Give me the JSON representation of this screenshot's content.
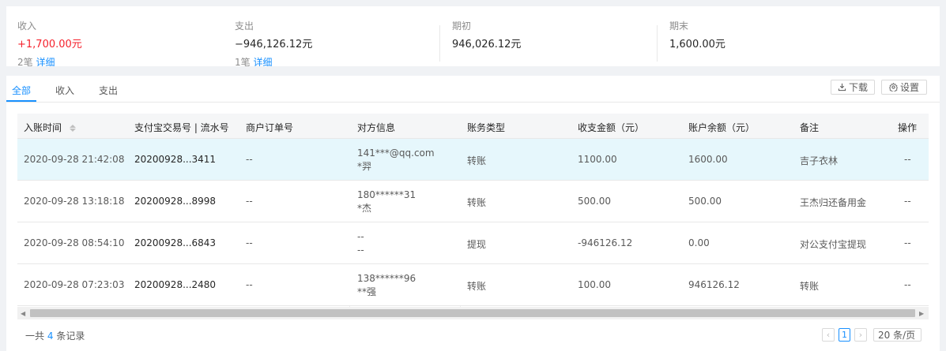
{
  "summary": {
    "income": {
      "label": "收入",
      "value": "+1,700.00元",
      "sub_count": "2笔",
      "sub_link": "详细"
    },
    "expense": {
      "label": "支出",
      "value": "−946,126.12元",
      "sub_count": "1笔",
      "sub_link": "详细"
    },
    "opening": {
      "label": "期初",
      "value": "946,026.12元"
    },
    "closing": {
      "label": "期末",
      "value": "1,600.00元"
    }
  },
  "tabs": [
    {
      "label": "全部",
      "active": true
    },
    {
      "label": "收入",
      "active": false
    },
    {
      "label": "支出",
      "active": false
    }
  ],
  "toolbar": {
    "download_label": "下载",
    "settings_label": "设置"
  },
  "table": {
    "columns": [
      "入账时间",
      "支付宝交易号 | 流水号",
      "商户订单号",
      "对方信息",
      "账务类型",
      "收支金额（元）",
      "账户余额（元）",
      "备注",
      "操作"
    ],
    "rows": [
      {
        "time": "2020-09-28 21:42:08",
        "trade_no": "20200928...3411",
        "order_no": "--",
        "party_account": "141***@qq.com",
        "party_name": "*羿",
        "type": "转账",
        "amount": "1100.00",
        "balance": "1600.00",
        "remark": "吉子衣林",
        "action": "--"
      },
      {
        "time": "2020-09-28 13:18:18",
        "trade_no": "20200928...8998",
        "order_no": "--",
        "party_account": "180******31",
        "party_name": "*杰",
        "type": "转账",
        "amount": "500.00",
        "balance": "500.00",
        "remark": "王杰归还备用金",
        "action": "--"
      },
      {
        "time": "2020-09-28 08:54:10",
        "trade_no": "20200928...6843",
        "order_no": "--",
        "party_account": "--",
        "party_name": "--",
        "type": "提现",
        "amount": "-946126.12",
        "balance": "0.00",
        "remark": "对公支付宝提现",
        "action": "--"
      },
      {
        "time": "2020-09-28 07:23:03",
        "trade_no": "20200928...2480",
        "order_no": "--",
        "party_account": "138******96",
        "party_name": "**强",
        "type": "转账",
        "amount": "100.00",
        "balance": "946126.12",
        "remark": "转账",
        "action": "--"
      }
    ]
  },
  "footer": {
    "total_prefix": "一共",
    "total_count": "4",
    "total_suffix": "条记录",
    "current_page": "1",
    "page_size": "20 条/页"
  },
  "colors": {
    "accent": "#1890ff",
    "income_red": "#f5222d",
    "selected_row": "#e6f7fc"
  },
  "icons": {
    "download": "download-icon",
    "settings": "gear-icon",
    "sort": "sort-icon"
  }
}
